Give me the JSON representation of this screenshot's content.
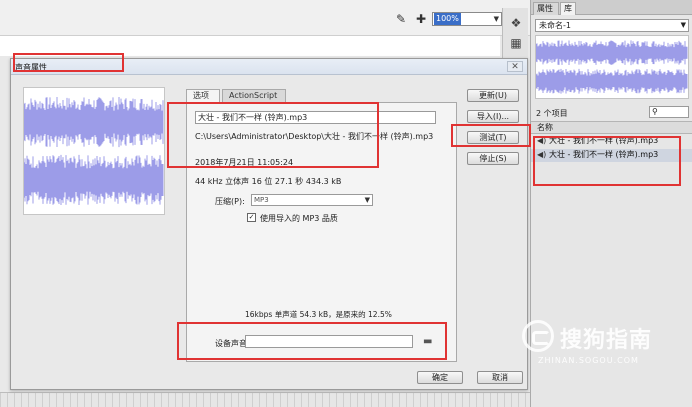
{
  "toolbar": {
    "zoom": "100%"
  },
  "dialog": {
    "title": "声音属性",
    "close_label": "✕",
    "tabs": [
      {
        "label": "选项"
      },
      {
        "label": "ActionScript"
      }
    ],
    "filename": "大壮 - 我们不一样 (铃声).mp3",
    "path": "C:\\Users\\Administrator\\Desktop\\大壮 - 我们不一样 (铃声).mp3",
    "date": "2018年7月21日  11:05:24",
    "format_info": "44 kHz 立体声 16 位 27.1 秒 434.3 kB",
    "compression_label": "压缩(P):",
    "compression_value": "MP3",
    "use_mp3_label": "使用导入的 MP3 品质",
    "use_mp3_checked": true,
    "bitrate_info": "16kbps  单声道 54.3 kB，是原来的 12.5%",
    "device_sound_label": "设备声音:",
    "device_sound_value": "",
    "buttons": {
      "update": "更新(U)",
      "import": "导入(I)...",
      "test": "测试(T)",
      "stop": "停止(S)",
      "ok": "确定",
      "cancel": "取消"
    }
  },
  "library": {
    "tabs": [
      {
        "label": "属性"
      },
      {
        "label": "库"
      }
    ],
    "document": "未命名-1",
    "item_count": "2 个项目",
    "search_placeholder": "",
    "column_name": "名称",
    "items": [
      {
        "name": "大壮 - 我们不一样 (铃声).mp3"
      },
      {
        "name": "大壮 - 我们不一样 (铃声).mp3"
      }
    ]
  },
  "watermark": {
    "text": "搜狗指南",
    "url": "ZHINAN.SOGOU.COM"
  },
  "colors": {
    "waveform": "#9c9ce8",
    "annotation": "#e03333",
    "selection": "#3a6ec8"
  }
}
